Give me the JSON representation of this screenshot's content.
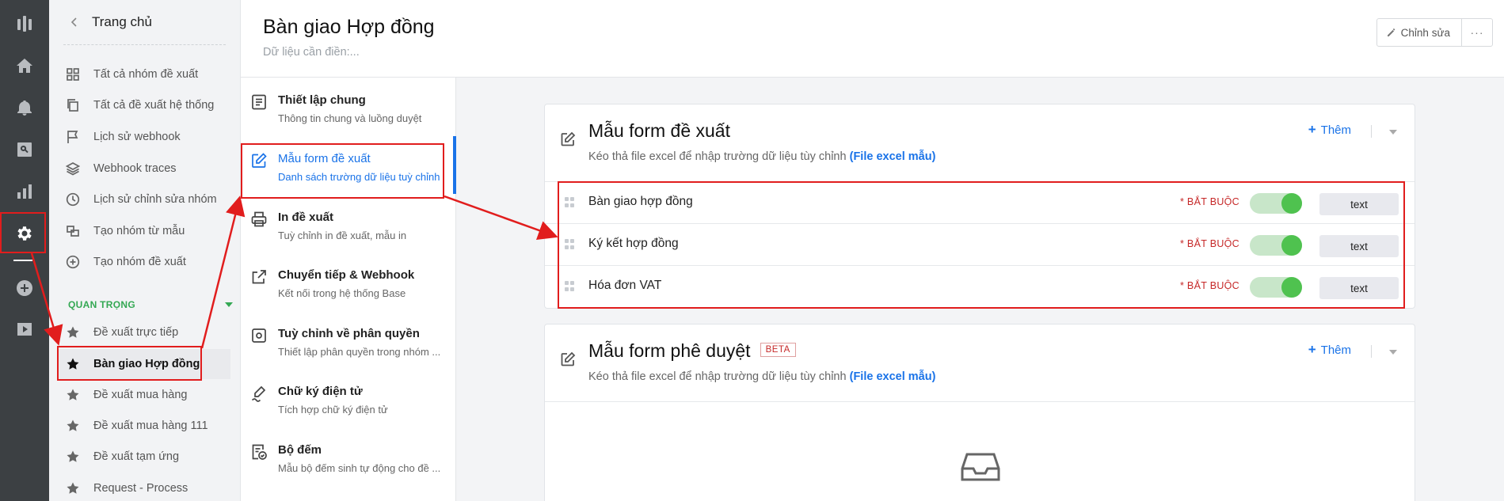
{
  "rail": {
    "items": [
      {
        "name": "logo-icon"
      },
      {
        "name": "home-icon"
      },
      {
        "name": "bell-icon"
      },
      {
        "name": "search-icon"
      },
      {
        "name": "chart-icon"
      },
      {
        "name": "gear-icon"
      },
      {
        "name": "plus-circle-icon"
      },
      {
        "name": "play-icon"
      }
    ]
  },
  "nav": {
    "back_label": "Trang chủ",
    "items": [
      {
        "label": "Tất cả nhóm đề xuất",
        "icon": "grid-icon"
      },
      {
        "label": "Tất cả đề xuất hệ thống",
        "icon": "copy-icon"
      },
      {
        "label": "Lịch sử webhook",
        "icon": "flag-icon"
      },
      {
        "label": "Webhook traces",
        "icon": "layers-icon"
      },
      {
        "label": "Lịch sử chỉnh sửa nhóm",
        "icon": "clock-icon"
      },
      {
        "label": "Tạo nhóm từ mẫu",
        "icon": "template-icon"
      },
      {
        "label": "Tạo nhóm đề xuất",
        "icon": "plus-circle-icon"
      }
    ],
    "section_label": "QUAN TRỌNG",
    "starred": [
      {
        "label": "Đề xuất trực tiếp"
      },
      {
        "label": "Bàn giao Hợp đồng"
      },
      {
        "label": "Đề xuất mua hàng"
      },
      {
        "label": "Đề xuất mua hàng 111"
      },
      {
        "label": "Đề xuất tạm ứng"
      },
      {
        "label": "Request - Process"
      }
    ]
  },
  "header": {
    "title": "Bàn giao Hợp đồng",
    "subtitle": "Dữ liệu cần điền:...",
    "edit_label": "Chỉnh sửa",
    "more_label": "···"
  },
  "settings": {
    "items": [
      {
        "title": "Thiết lập chung",
        "desc": "Thông tin chung và luồng duyệt",
        "icon": "document-icon"
      },
      {
        "title": "Mẫu form đề xuất",
        "desc": "Danh sách trường dữ liệu tuỳ chỉnh",
        "icon": "edit-icon"
      },
      {
        "title": "In đề xuất",
        "desc": "Tuỳ chỉnh in đề xuất, mẫu in",
        "icon": "printer-icon"
      },
      {
        "title": "Chuyển tiếp & Webhook",
        "desc": "Kết nối trong hệ thống Base",
        "icon": "share-icon"
      },
      {
        "title": "Tuỳ chỉnh về phân quyền",
        "desc": "Thiết lập phân quyền trong nhóm ...",
        "icon": "settings-icon"
      },
      {
        "title": "Chữ ký điện tử",
        "desc": "Tích hợp chữ ký điện tử",
        "icon": "signature-icon"
      },
      {
        "title": "Bộ đếm",
        "desc": "Mẫu bộ đếm sinh tự động cho đề ...",
        "icon": "counter-icon"
      }
    ]
  },
  "form_card": {
    "title": "Mẫu form đề xuất",
    "desc": "Kéo thả file excel để nhập trường dữ liệu tùy chỉnh",
    "link": "(File excel mẫu)",
    "add_label": "Thêm",
    "fields": [
      {
        "name": "Bàn giao hợp đồng",
        "required": "* BẮT BUỘC",
        "type": "text"
      },
      {
        "name": "Ký kết hợp đồng",
        "required": "* BẮT BUỘC",
        "type": "text"
      },
      {
        "name": "Hóa đơn VAT",
        "required": "* BẮT BUỘC",
        "type": "text"
      }
    ]
  },
  "approval_card": {
    "title": "Mẫu form phê duyệt",
    "badge": "BETA",
    "desc": "Kéo thả file excel để nhập trường dữ liệu tùy chỉnh",
    "link": "(File excel mẫu)",
    "add_label": "Thêm"
  },
  "colors": {
    "accent": "#1a73e8",
    "rail_bg": "#3c4043",
    "annotation": "#e11d1d",
    "toggle_on": "#4fc24f",
    "section_green": "#34a853"
  }
}
